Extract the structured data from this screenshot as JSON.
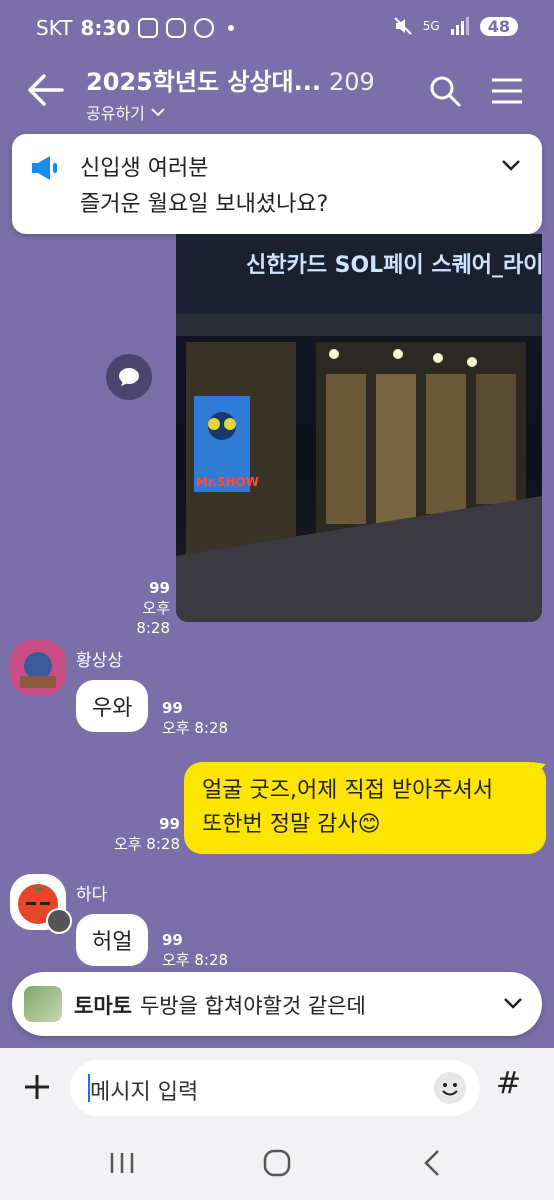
{
  "status": {
    "carrier": "SKT",
    "time": "8:30",
    "network": "5G",
    "battery": "48"
  },
  "header": {
    "title": "2025학년도 상상대...",
    "member_count": "209",
    "share_label": "공유하기"
  },
  "notice": {
    "line1": "신입생 여러분",
    "line2": "즐거운 월요일 보내셨나요?"
  },
  "photo": {
    "sign_text": "신한카드 SOL페이 스퀘어_라이브홀",
    "poster_text": "Mr.SHOW"
  },
  "messages": [
    {
      "unread": "99",
      "time": "오후 8:28"
    },
    {
      "sender": "황상상",
      "text": "우와",
      "unread": "99",
      "time": "오후 8:28"
    },
    {
      "text_line1": "얼굴 굿즈,어제 직접 받아주셔서",
      "text_line2": "또한번 정말 감사😊",
      "unread": "99",
      "time": "오후 8:28"
    },
    {
      "sender": "하다",
      "text": "허얼",
      "unread": "99",
      "time": "오후 8:28"
    }
  ],
  "mini_notice": {
    "sender": "토마토",
    "text": "두방을 합쳐야할것 같은데"
  },
  "input": {
    "placeholder": "메시지 입력"
  },
  "colors": {
    "background": "#7a6fa9",
    "my_bubble": "#fee500",
    "their_bubble": "#ffffff"
  }
}
